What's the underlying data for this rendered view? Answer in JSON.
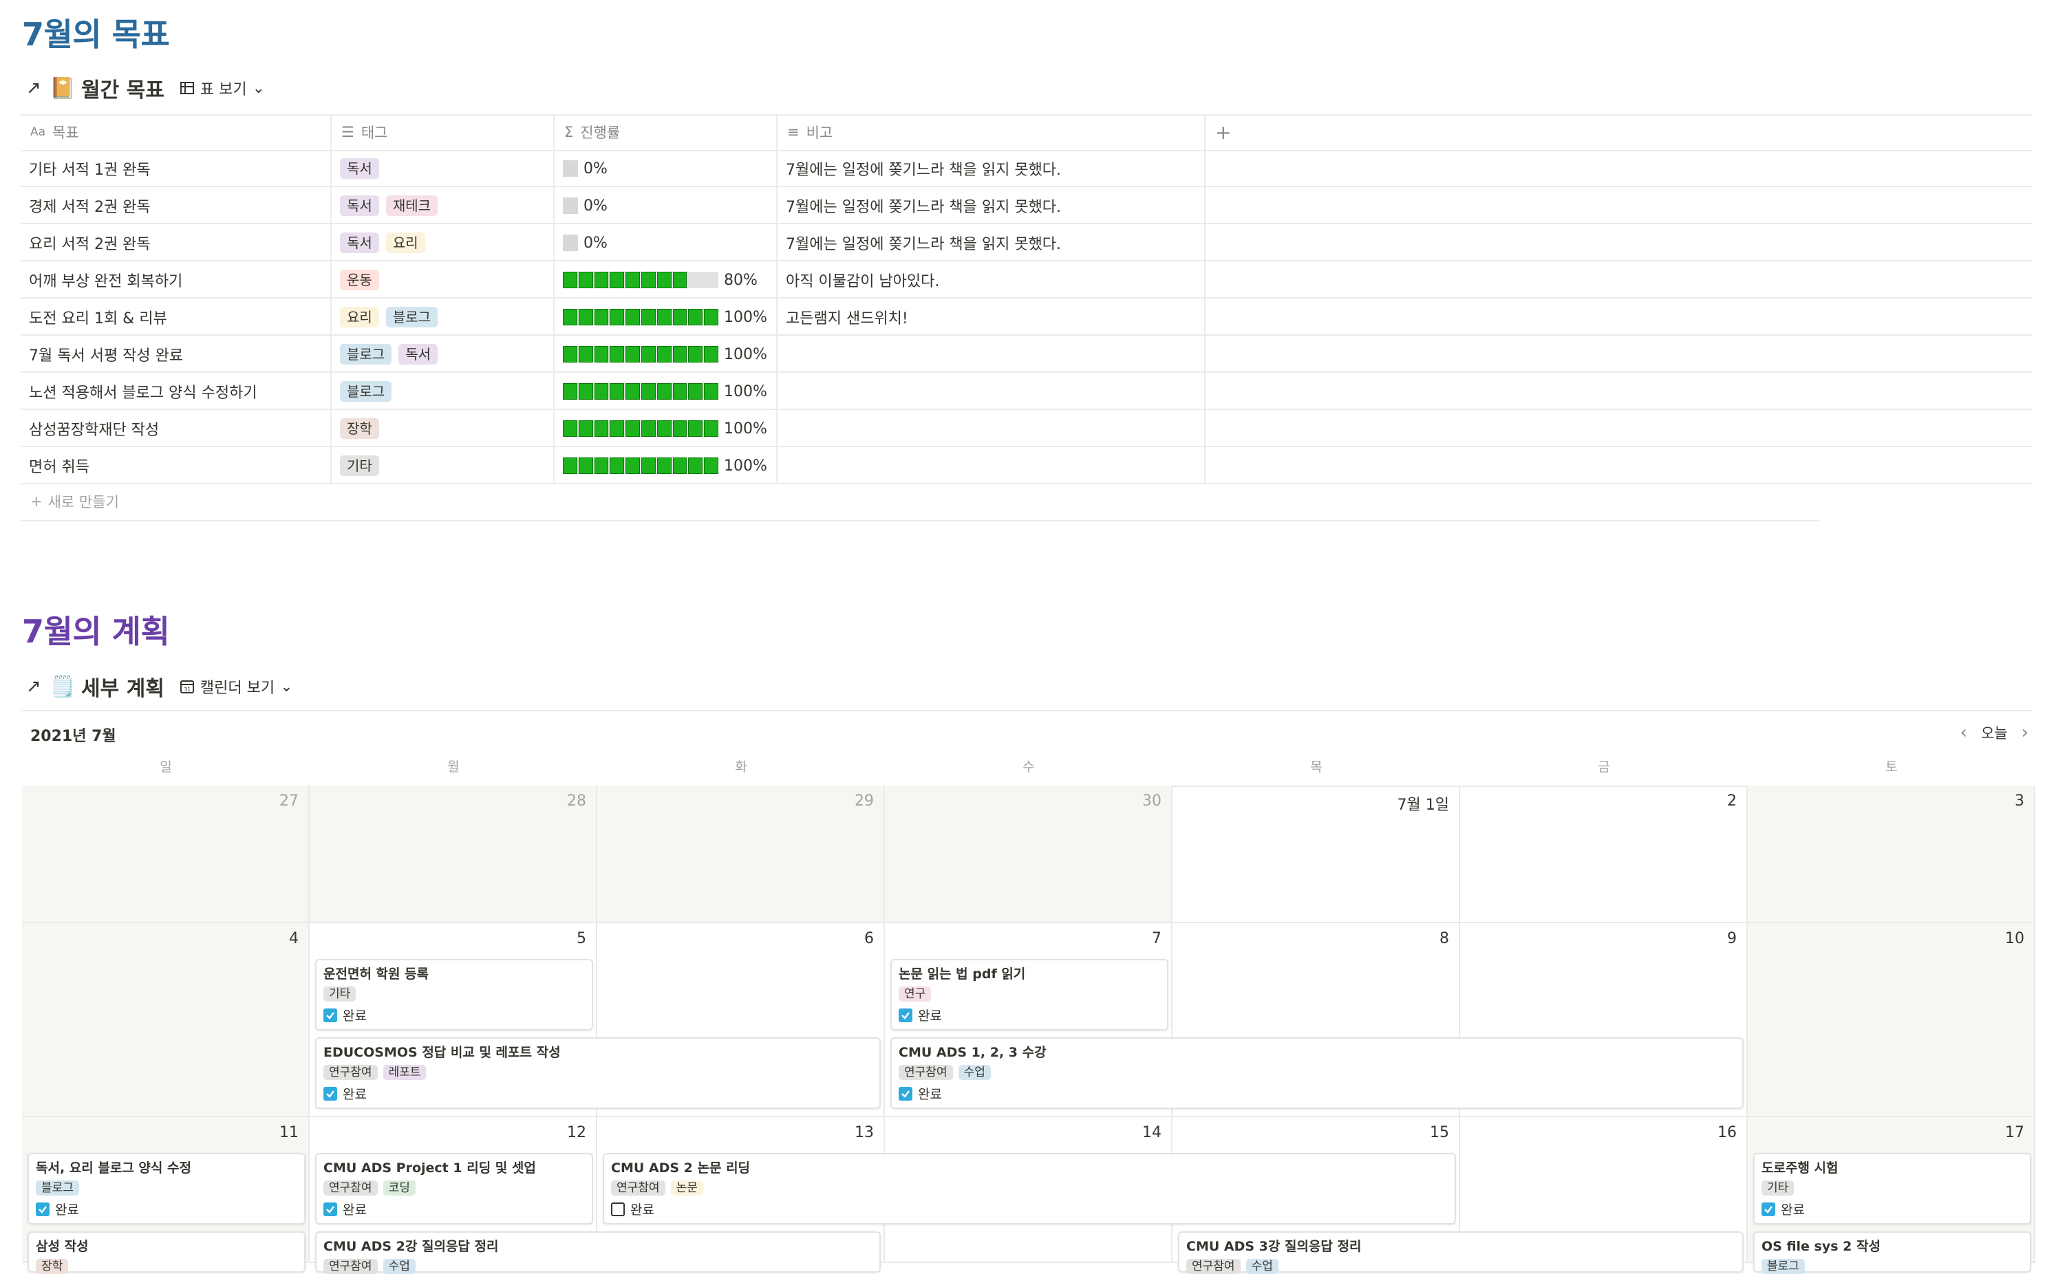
{
  "section1": {
    "title": "7월의 목표",
    "db_title": "월간 목표",
    "view_label": "표 보기"
  },
  "table": {
    "columns": [
      "목표",
      "태그",
      "진행률",
      "비고"
    ],
    "rows": [
      {
        "goal": "기타 서적 1권 완독",
        "tags": [
          "독서"
        ],
        "progress": 0,
        "progress_label": "0%",
        "note": "7월에는 일정에 쫒기느라 책을 읽지 못했다."
      },
      {
        "goal": "경제 서적 2권 완독",
        "tags": [
          "독서",
          "재테크"
        ],
        "progress": 0,
        "progress_label": "0%",
        "note": "7월에는 일정에 쫒기느라 책을 읽지 못했다."
      },
      {
        "goal": "요리 서적 2권 완독",
        "tags": [
          "독서",
          "요리"
        ],
        "progress": 0,
        "progress_label": "0%",
        "note": "7월에는 일정에 쫒기느라 책을 읽지 못했다."
      },
      {
        "goal": "어깨 부상 완전 회복하기",
        "tags": [
          "운동"
        ],
        "progress": 80,
        "progress_label": "80%",
        "note": "아직 이물감이 남아있다."
      },
      {
        "goal": "도전 요리 1회 & 리뷰",
        "tags": [
          "요리",
          "블로그"
        ],
        "progress": 100,
        "progress_label": "100%",
        "note": "고든램지 샌드위치!"
      },
      {
        "goal": "7월 독서 서평 작성 완료",
        "tags": [
          "블로그",
          "독서"
        ],
        "progress": 100,
        "progress_label": "100%",
        "note": ""
      },
      {
        "goal": "노션 적용해서 블로그 양식 수정하기",
        "tags": [
          "블로그"
        ],
        "progress": 100,
        "progress_label": "100%",
        "note": ""
      },
      {
        "goal": "삼성꿈장학재단 작성",
        "tags": [
          "장학"
        ],
        "progress": 100,
        "progress_label": "100%",
        "note": ""
      },
      {
        "goal": "면허 취득",
        "tags": [
          "기타"
        ],
        "progress": 100,
        "progress_label": "100%",
        "note": ""
      }
    ],
    "new_label": "새로 만들기",
    "add_column": "+"
  },
  "tag_colors": {
    "독서": "#e8deee",
    "재테크": "#f5e0e9",
    "요리": "#fbf3db",
    "운동": "#ffe2dd",
    "블로그": "#d3e5ef",
    "장학": "#eee0da",
    "기타": "#e3e2e0",
    "연구": "#f5e0e9",
    "연구참여": "#e3e2e0",
    "레포트": "#e8deee",
    "수업": "#d3e5ef",
    "코딩": "#dbeddb",
    "논문": "#fbf3db"
  },
  "section2": {
    "title": "7월의 계획",
    "db_title": "세부 계획",
    "view_label": "캘린더 보기"
  },
  "calendar": {
    "month_label": "2021년 7월",
    "today_label": "오늘",
    "weekdays": [
      "일",
      "월",
      "화",
      "수",
      "목",
      "금",
      "토"
    ],
    "week1": [
      "27",
      "28",
      "29",
      "30",
      "7월 1일",
      "2",
      "3"
    ],
    "week2": [
      "4",
      "5",
      "6",
      "7",
      "8",
      "9",
      "10"
    ],
    "week3": [
      "11",
      "12",
      "13",
      "14",
      "15",
      "16",
      "17"
    ],
    "done_label": "완료",
    "events": [
      {
        "title": "운전면허 학원 등록",
        "tags": [
          "기타"
        ],
        "done": true
      },
      {
        "title": "논문 읽는 법 pdf 읽기",
        "tags": [
          "연구"
        ],
        "done": true
      },
      {
        "title": "EDUCOSMOS 정답 비교 및 레포트 작성",
        "tags": [
          "연구참여",
          "레포트"
        ],
        "done": true
      },
      {
        "title": "CMU ADS 1, 2, 3 수강",
        "tags": [
          "연구참여",
          "수업"
        ],
        "done": true
      },
      {
        "title": "독서, 요리 블로그 양식 수정",
        "tags": [
          "블로그"
        ],
        "done": true
      },
      {
        "title": "CMU ADS Project 1 리딩 및 셋업",
        "tags": [
          "연구참여",
          "코딩"
        ],
        "done": true
      },
      {
        "title": "CMU ADS 2 논문 리딩",
        "tags": [
          "연구참여",
          "논문"
        ],
        "done": false
      },
      {
        "title": "도로주행 시험",
        "tags": [
          "기타"
        ],
        "done": true
      },
      {
        "title": "삼성 작성",
        "tags": [
          "장학"
        ]
      },
      {
        "title": "CMU ADS 2강 질의응답 정리",
        "tags": [
          "연구참여",
          "수업"
        ]
      },
      {
        "title": "CMU ADS 3강 질의응답 정리",
        "tags": [
          "연구참여",
          "수업"
        ]
      },
      {
        "title": "OS file sys 2 작성",
        "tags": [
          "블로그"
        ]
      }
    ]
  }
}
